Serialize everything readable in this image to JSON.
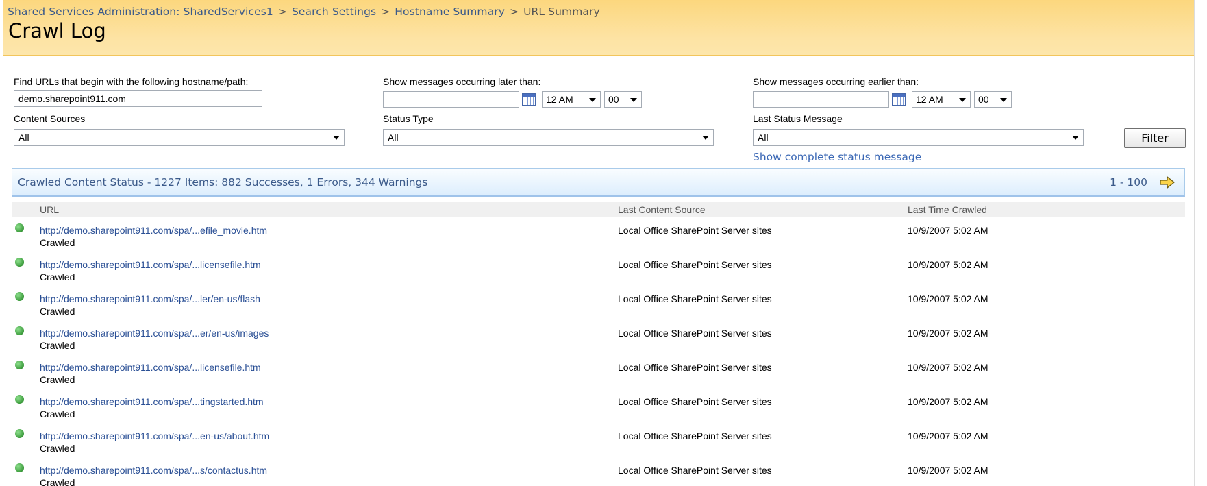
{
  "breadcrumb": [
    {
      "label": "Shared Services Administration: SharedServices1"
    },
    {
      "label": "Search Settings"
    },
    {
      "label": "Hostname Summary"
    },
    {
      "label": "URL Summary"
    }
  ],
  "breadcrumb_separator": ">",
  "page_title": "Crawl Log",
  "filters": {
    "hostname_label": "Find URLs that begin with the following hostname/path:",
    "hostname_value": "demo.sharepoint911.com",
    "later_label": "Show messages occurring later than:",
    "later_date_value": "",
    "later_hour": "12 AM",
    "later_minute": "00",
    "earlier_label": "Show messages occurring earlier than:",
    "earlier_date_value": "",
    "earlier_hour": "12 AM",
    "earlier_minute": "00",
    "content_sources_label": "Content Sources",
    "content_sources_value": "All",
    "status_type_label": "Status Type",
    "status_type_value": "All",
    "last_status_label": "Last Status Message",
    "last_status_value": "All",
    "filter_button": "Filter",
    "show_complete_link": "Show complete status message"
  },
  "summary": {
    "text": "Crawled Content Status - 1227 Items: 882 Successes, 1 Errors, 344 Warnings",
    "paging": "1 - 100"
  },
  "columns": {
    "url": "URL",
    "source": "Last Content Source",
    "time": "Last Time Crawled"
  },
  "rows": [
    {
      "url": "http://demo.sharepoint911.com/spa/...efile_movie.htm",
      "status": "Crawled",
      "source": "Local Office SharePoint Server sites",
      "time": "10/9/2007 5:02 AM"
    },
    {
      "url": "http://demo.sharepoint911.com/spa/...licensefile.htm",
      "status": "Crawled",
      "source": "Local Office SharePoint Server sites",
      "time": "10/9/2007 5:02 AM"
    },
    {
      "url": "http://demo.sharepoint911.com/spa/...ler/en-us/flash",
      "status": "Crawled",
      "source": "Local Office SharePoint Server sites",
      "time": "10/9/2007 5:02 AM"
    },
    {
      "url": "http://demo.sharepoint911.com/spa/...er/en-us/images",
      "status": "Crawled",
      "source": "Local Office SharePoint Server sites",
      "time": "10/9/2007 5:02 AM"
    },
    {
      "url": "http://demo.sharepoint911.com/spa/...licensefile.htm",
      "status": "Crawled",
      "source": "Local Office SharePoint Server sites",
      "time": "10/9/2007 5:02 AM"
    },
    {
      "url": "http://demo.sharepoint911.com/spa/...tingstarted.htm",
      "status": "Crawled",
      "source": "Local Office SharePoint Server sites",
      "time": "10/9/2007 5:02 AM"
    },
    {
      "url": "http://demo.sharepoint911.com/spa/...en-us/about.htm",
      "status": "Crawled",
      "source": "Local Office SharePoint Server sites",
      "time": "10/9/2007 5:02 AM"
    },
    {
      "url": "http://demo.sharepoint911.com/spa/...s/contactus.htm",
      "status": "Crawled",
      "source": "Local Office SharePoint Server sites",
      "time": "10/9/2007 5:02 AM"
    }
  ],
  "icons": {
    "status_dot": "success-status-icon",
    "calendar": "calendar-icon",
    "next_page": "next-page-arrow-icon"
  },
  "colors": {
    "header_band": "#fcd77e",
    "link": "#3b5a8a",
    "status_bar": "#ddeefd",
    "success": "#3b9a3b"
  }
}
